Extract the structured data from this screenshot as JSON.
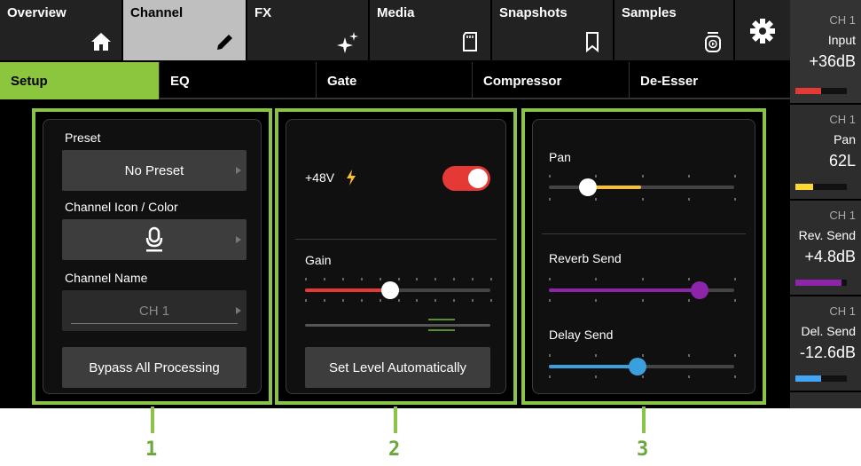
{
  "top_tabs": [
    {
      "label": "Overview",
      "icon": "home-icon"
    },
    {
      "label": "Channel",
      "icon": "pencil-icon"
    },
    {
      "label": "FX",
      "icon": "sparkle-icon"
    },
    {
      "label": "Media",
      "icon": "sd-card-icon"
    },
    {
      "label": "Snapshots",
      "icon": "bookmark-icon"
    },
    {
      "label": "Samples",
      "icon": "sample-pad-icon"
    }
  ],
  "settings_icon": "gear-icon",
  "sub_tabs": [
    {
      "label": "Setup"
    },
    {
      "label": "EQ"
    },
    {
      "label": "Gate"
    },
    {
      "label": "Compressor"
    },
    {
      "label": "De-Esser"
    }
  ],
  "panel1": {
    "preset_label": "Preset",
    "preset_value": "No Preset",
    "icon_color_label": "Channel Icon / Color",
    "channel_icon": "microphone-icon",
    "name_label": "Channel Name",
    "name_value": "CH 1",
    "bypass_label": "Bypass All Processing"
  },
  "panel2": {
    "phantom_label": "+48V",
    "phantom_on": true,
    "gain_label": "Gain",
    "auto_level_label": "Set Level Automatically"
  },
  "panel3": {
    "pan_label": "Pan",
    "reverb_label": "Reverb Send",
    "delay_label": "Delay Send"
  },
  "meters": [
    {
      "ch": "CH 1",
      "name": "Input",
      "value": "+36dB",
      "color": "#e53935",
      "level": 0.5
    },
    {
      "ch": "CH 1",
      "name": "Pan",
      "value": "62L",
      "color": "#fdd835",
      "level": 0.35
    },
    {
      "ch": "CH 1",
      "name": "Rev. Send",
      "value": "+4.8dB",
      "color": "#8e24aa",
      "level": 0.9
    },
    {
      "ch": "CH 1",
      "name": "Del. Send",
      "value": "-12.6dB",
      "color": "#42a5f5",
      "level": 0.5
    }
  ],
  "callouts": [
    "1",
    "2",
    "3"
  ],
  "colors": {
    "accent": "#8bc34a",
    "toggle_on": "#e53935",
    "gain": "#e53935",
    "pan": "#fbc02d",
    "reverb": "#8e24aa",
    "delay": "#3aa0dd"
  }
}
